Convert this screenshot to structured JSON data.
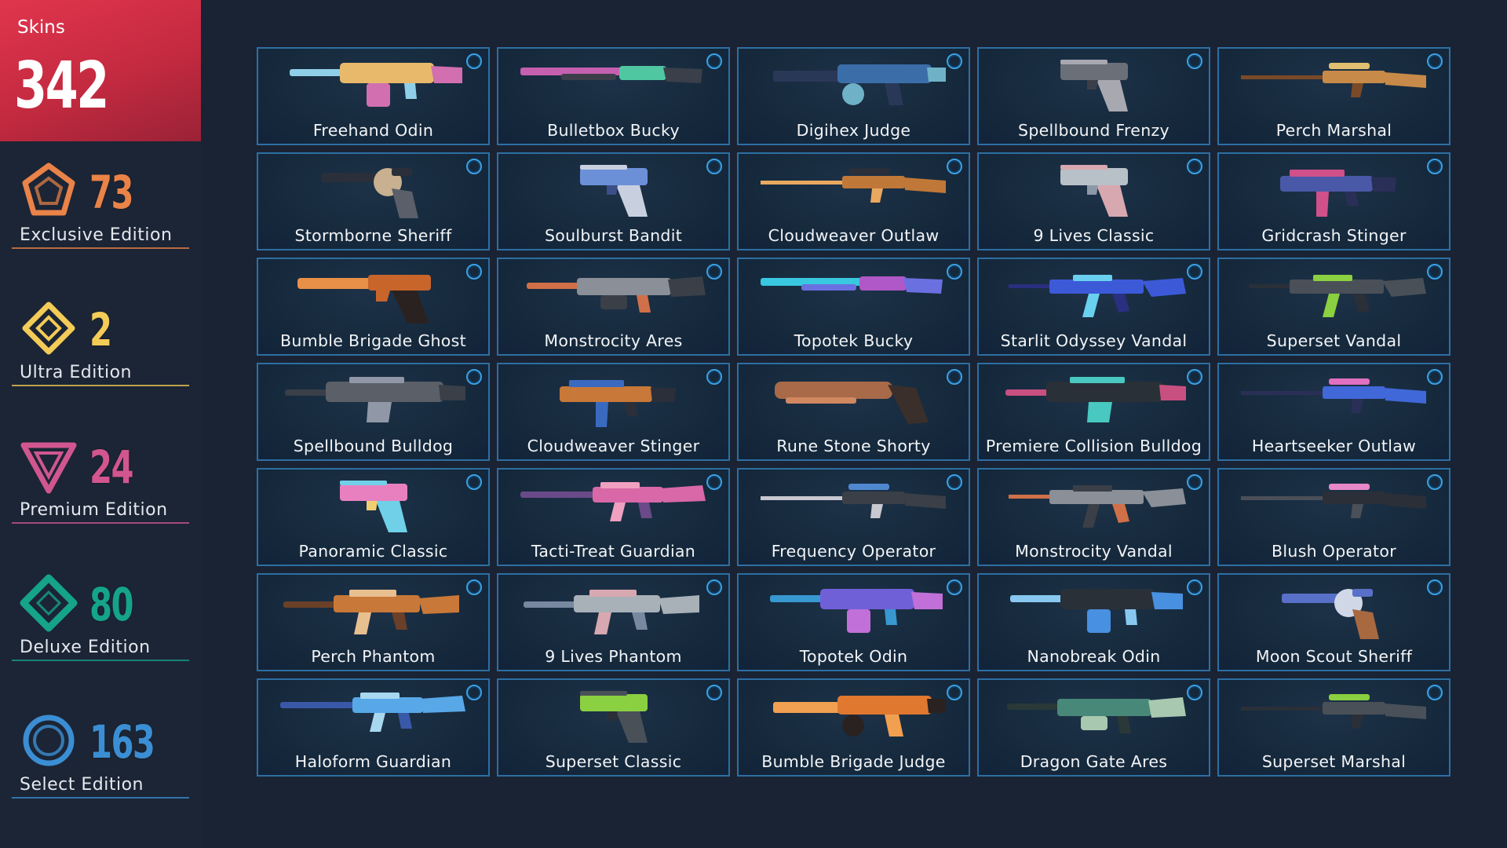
{
  "total": {
    "label": "Skins",
    "value": "342",
    "color": "#d53148"
  },
  "editions": [
    {
      "count": "73",
      "name": "Exclusive Edition",
      "color": "#e98348",
      "icon": "exclusive-edition-pentagon-icon"
    },
    {
      "count": "2",
      "name": "Ultra Edition",
      "color": "#f3cb57",
      "icon": "ultra-edition-diamond-icon"
    },
    {
      "count": "24",
      "name": "Premium Edition",
      "color": "#d1568f",
      "icon": "premium-edition-triangle-icon"
    },
    {
      "count": "80",
      "name": "Deluxe Edition",
      "color": "#15a38a",
      "icon": "deluxe-edition-diamond-icon"
    },
    {
      "count": "163",
      "name": "Select Edition",
      "color": "#3b8ed3",
      "icon": "select-edition-circle-icon"
    }
  ],
  "skins": [
    {
      "name": "Freehand Odin",
      "weapon": "odin",
      "colors": [
        "#e8b96a",
        "#d16fb0",
        "#8fd0e8"
      ]
    },
    {
      "name": "Bulletbox Bucky",
      "weapon": "shotgun",
      "colors": [
        "#3a3f4a",
        "#4fc7a0",
        "#c55fb0"
      ]
    },
    {
      "name": "Digihex Judge",
      "weapon": "judge",
      "colors": [
        "#3b6ea8",
        "#6fb2c8",
        "#2a3858"
      ]
    },
    {
      "name": "Spellbound Frenzy",
      "weapon": "pistol",
      "colors": [
        "#6a6f78",
        "#a8a8b0",
        "#3a3f4a"
      ]
    },
    {
      "name": "Perch Marshal",
      "weapon": "sniper",
      "colors": [
        "#c78a48",
        "#e0c070",
        "#7a4a28"
      ]
    },
    {
      "name": "Stormborne Sheriff",
      "weapon": "revolver",
      "colors": [
        "#2a2f3a",
        "#c8b090",
        "#5a5f6a"
      ]
    },
    {
      "name": "Soulburst Bandit",
      "weapon": "pistol",
      "colors": [
        "#6c90d8",
        "#c8d0e0",
        "#3a4f88"
      ]
    },
    {
      "name": "Cloudweaver Outlaw",
      "weapon": "sniper",
      "colors": [
        "#c07838",
        "#2a2f3a",
        "#e8a860"
      ]
    },
    {
      "name": "9 Lives Classic",
      "weapon": "pistol",
      "colors": [
        "#b8c0c8",
        "#d8a8b0",
        "#8a98a8"
      ]
    },
    {
      "name": "Gridcrash Stinger",
      "weapon": "smg",
      "colors": [
        "#4a58a8",
        "#d0508a",
        "#2a2f58"
      ]
    },
    {
      "name": "Bumble Brigade Ghost",
      "weapon": "ghost",
      "colors": [
        "#c8652a",
        "#2a2220",
        "#e89048"
      ]
    },
    {
      "name": "Monstrocity Ares",
      "weapon": "ares",
      "colors": [
        "#8a8f98",
        "#3a3f48",
        "#d07048"
      ]
    },
    {
      "name": "Topotek Bucky",
      "weapon": "shotgun",
      "colors": [
        "#6a70e0",
        "#b058c8",
        "#38c8e0"
      ]
    },
    {
      "name": "Starlit Odyssey Vandal",
      "weapon": "rifle",
      "colors": [
        "#3c5ad8",
        "#6ad0f0",
        "#2a2f80"
      ]
    },
    {
      "name": "Superset Vandal",
      "weapon": "rifle",
      "colors": [
        "#4a5058",
        "#8ad040",
        "#2a2f38"
      ]
    },
    {
      "name": "Spellbound Bulldog",
      "weapon": "bulldog",
      "colors": [
        "#5a5f68",
        "#9098a8",
        "#3a3f48"
      ]
    },
    {
      "name": "Cloudweaver Stinger",
      "weapon": "smg",
      "colors": [
        "#c87838",
        "#3a6ac0",
        "#2a2f3a"
      ]
    },
    {
      "name": "Rune Stone Shorty",
      "weapon": "shorty",
      "colors": [
        "#a86a48",
        "#3a2f2a",
        "#d08860"
      ]
    },
    {
      "name": "Premiere Collision Bulldog",
      "weapon": "bulldog",
      "colors": [
        "#2a3038",
        "#48c8c0",
        "#c85080"
      ]
    },
    {
      "name": "Heartseeker Outlaw",
      "weapon": "sniper",
      "colors": [
        "#4068d8",
        "#e070c0",
        "#2a2f58"
      ]
    },
    {
      "name": "Panoramic Classic",
      "weapon": "pistol",
      "colors": [
        "#e880c0",
        "#70d0e8",
        "#f0d070"
      ]
    },
    {
      "name": "Tacti-Treat Guardian",
      "weapon": "guardian",
      "colors": [
        "#d868a8",
        "#f0a0c0",
        "#6a4a88"
      ]
    },
    {
      "name": "Frequency Operator",
      "weapon": "sniper",
      "colors": [
        "#3a3f48",
        "#5088d0",
        "#c8c8d0"
      ]
    },
    {
      "name": "Monstrocity Vandal",
      "weapon": "rifle",
      "colors": [
        "#8a8f98",
        "#3a3f48",
        "#d07048"
      ]
    },
    {
      "name": "Blush Operator",
      "weapon": "sniper",
      "colors": [
        "#2a2f38",
        "#e888c8",
        "#4a4f58"
      ]
    },
    {
      "name": "Perch Phantom",
      "weapon": "phantom",
      "colors": [
        "#c87838",
        "#e8c090",
        "#6a4028"
      ]
    },
    {
      "name": "9 Lives Phantom",
      "weapon": "phantom",
      "colors": [
        "#a8b0b8",
        "#d8a8b0",
        "#7888a0"
      ]
    },
    {
      "name": "Topotek Odin",
      "weapon": "odin",
      "colors": [
        "#7060d8",
        "#c070d8",
        "#3898d0"
      ]
    },
    {
      "name": "Nanobreak Odin",
      "weapon": "odin",
      "colors": [
        "#2a3038",
        "#4890e0",
        "#88c8f0"
      ]
    },
    {
      "name": "Moon Scout Sheriff",
      "weapon": "revolver",
      "colors": [
        "#5870c8",
        "#d0d8e8",
        "#a86840"
      ]
    },
    {
      "name": "Haloform Guardian",
      "weapon": "guardian",
      "colors": [
        "#58a8e8",
        "#a8d8f0",
        "#3a58a8"
      ]
    },
    {
      "name": "Superset Classic",
      "weapon": "pistol",
      "colors": [
        "#8ad040",
        "#4a5058",
        "#2a2f38"
      ]
    },
    {
      "name": "Bumble Brigade Judge",
      "weapon": "judge",
      "colors": [
        "#e07830",
        "#2a2220",
        "#f0a050"
      ]
    },
    {
      "name": "Dragon Gate Ares",
      "weapon": "ares",
      "colors": [
        "#488878",
        "#a8c8b0",
        "#2a3838"
      ]
    },
    {
      "name": "Superset Marshal",
      "weapon": "sniper",
      "colors": [
        "#4a5058",
        "#8ad040",
        "#2a2f38"
      ]
    }
  ]
}
